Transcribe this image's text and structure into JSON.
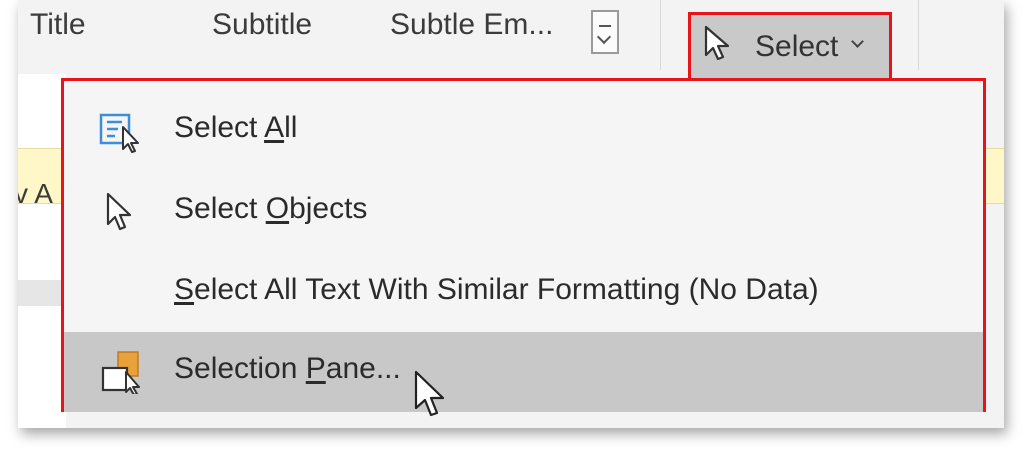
{
  "ribbon": {
    "styles": [
      {
        "label": "Title"
      },
      {
        "label": "Subtitle"
      },
      {
        "label": "Subtle Em..."
      }
    ],
    "select_button": {
      "label": "Select"
    }
  },
  "document": {
    "partial_text": "v A"
  },
  "menu": {
    "items": [
      {
        "pre": "Select ",
        "key": "A",
        "post": "ll",
        "icon": "select-all-icon"
      },
      {
        "pre": "Select ",
        "key": "O",
        "post": "bjects",
        "icon": "select-objects-icon"
      },
      {
        "pre": "",
        "key": "S",
        "post": "elect All Text With Similar Formatting (No Data)",
        "icon": "none"
      },
      {
        "pre": "Selection ",
        "key": "P",
        "post": "ane...",
        "icon": "selection-pane-icon"
      }
    ]
  },
  "colors": {
    "highlight_border": "#e8141b",
    "hover_background": "#c8c8c8",
    "accent_blue": "#3c8fd6",
    "accent_orange": "#e9a23b"
  }
}
